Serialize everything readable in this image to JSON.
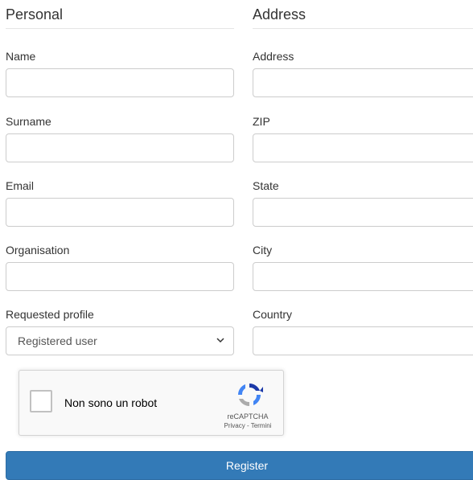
{
  "personal": {
    "title": "Personal",
    "name_label": "Name",
    "surname_label": "Surname",
    "email_label": "Email",
    "organisation_label": "Organisation",
    "profile_label": "Requested profile",
    "profile_value": "Registered user",
    "name_value": "",
    "surname_value": "",
    "email_value": "",
    "organisation_value": ""
  },
  "address": {
    "title": "Address",
    "address_label": "Address",
    "zip_label": "ZIP",
    "state_label": "State",
    "city_label": "City",
    "country_label": "Country",
    "address_value": "",
    "zip_value": "",
    "state_value": "",
    "city_value": "",
    "country_value": ""
  },
  "captcha": {
    "label": "Non sono un robot",
    "brand": "reCAPTCHA",
    "links": "Privacy - Termini",
    "checked": false
  },
  "actions": {
    "register_label": "Register"
  },
  "colors": {
    "primary": "#337ab7",
    "border": "#cccccc"
  }
}
